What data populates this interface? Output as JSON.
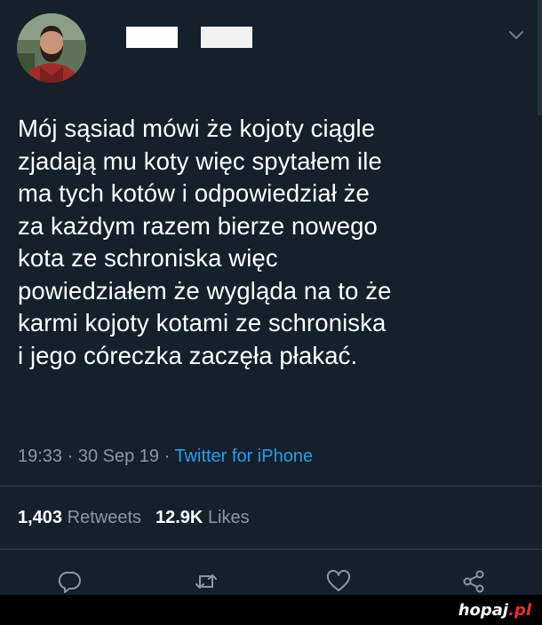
{
  "tweet": {
    "lines": [
      "Mój sąsiad mówi że kojoty ciągle",
      "zjadają mu koty więc spytałem ile",
      "ma tych kotów i odpowiedział że",
      "za każdym razem bierze nowego",
      "kota ze schroniska więc",
      "powiedziałem że wygląda na to że",
      "karmi kojoty kotami ze schroniska",
      "i jego córeczka zaczęła płakać."
    ],
    "time": "19:33 · 30 Sep 19 · ",
    "source": "Twitter for iPhone"
  },
  "stats": {
    "retweets_count": "1,403",
    "retweets_label": "Retweets",
    "likes_count": "12.9K",
    "likes_label": "Likes"
  },
  "icons": {
    "reply": "reply-icon",
    "retweet": "retweet-icon",
    "like": "heart-icon",
    "share": "share-icon",
    "menu": "chevron-down-icon"
  },
  "colors": {
    "background": "#15202b",
    "text": "#ffffff",
    "muted": "#8899a6",
    "link": "#1da1f2",
    "watermark_accent": "#e0312f"
  },
  "watermark": {
    "name": "hopaj",
    "tld": ".pl"
  }
}
